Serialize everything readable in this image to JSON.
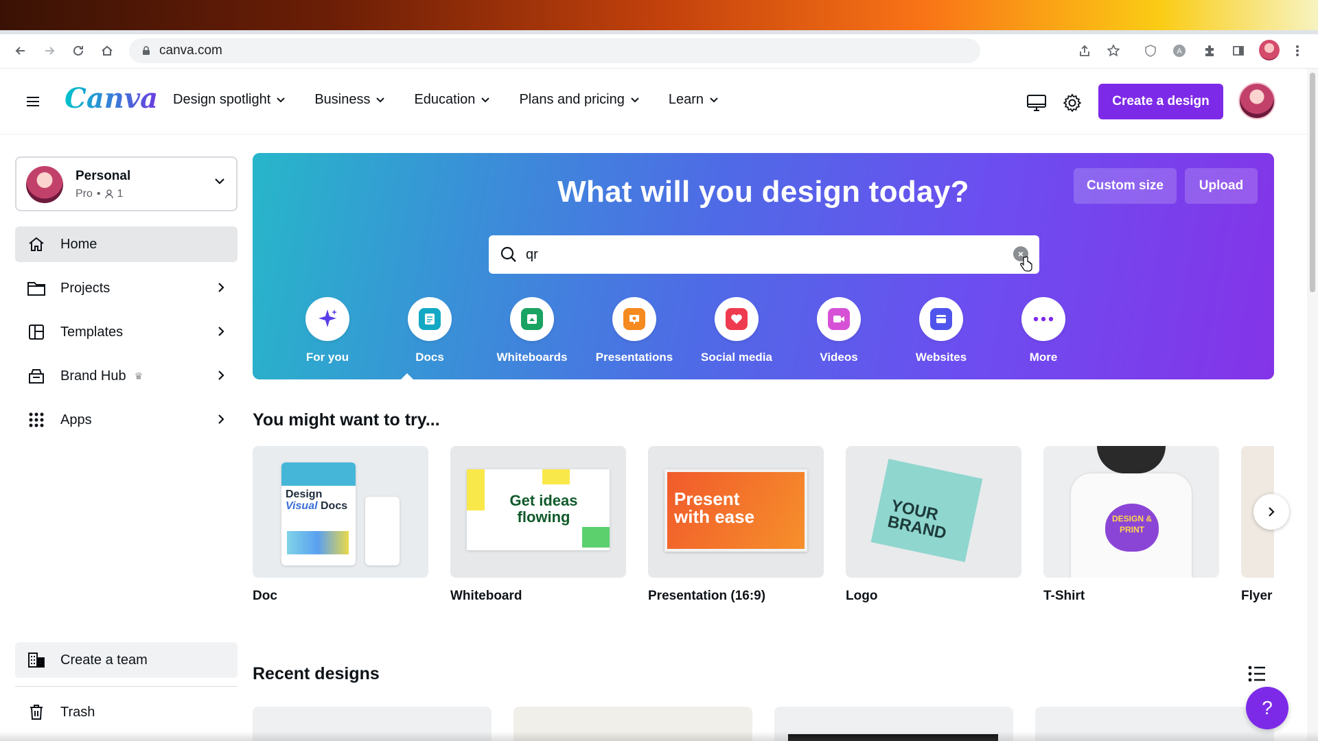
{
  "browser": {
    "url": "canva.com"
  },
  "header": {
    "logo": "Canva",
    "nav": [
      {
        "label": "Design spotlight"
      },
      {
        "label": "Business"
      },
      {
        "label": "Education"
      },
      {
        "label": "Plans and pricing"
      },
      {
        "label": "Learn"
      }
    ],
    "create_label": "Create a design",
    "icons": [
      "desktop-icon",
      "gear-icon"
    ]
  },
  "sidebar": {
    "account": {
      "name": "Personal",
      "plan": "Pro",
      "members": "1"
    },
    "items": [
      {
        "label": "Home",
        "icon": "home-icon",
        "active": true
      },
      {
        "label": "Projects",
        "icon": "folder-icon"
      },
      {
        "label": "Templates",
        "icon": "templates-icon"
      },
      {
        "label": "Brand Hub",
        "icon": "brand-hub-icon",
        "badge": "♛"
      },
      {
        "label": "Apps",
        "icon": "apps-grid-icon"
      }
    ],
    "create_team_label": "Create a team",
    "trash_label": "Trash"
  },
  "hero": {
    "title": "What will you design today?",
    "custom_size_label": "Custom size",
    "upload_label": "Upload",
    "search_value": "qr",
    "categories": [
      {
        "label": "For you",
        "icon": "sparkle-icon",
        "color": "#5b3ee8"
      },
      {
        "label": "Docs",
        "icon": "docs-icon",
        "color": "#13a8c4"
      },
      {
        "label": "Whiteboards",
        "icon": "whiteboard-icon",
        "color": "#1aa362"
      },
      {
        "label": "Presentations",
        "icon": "presentation-icon",
        "color": "#f58a1f"
      },
      {
        "label": "Social media",
        "icon": "heart-icon",
        "color": "#ef3b4f"
      },
      {
        "label": "Videos",
        "icon": "video-icon",
        "color": "#d651d6"
      },
      {
        "label": "Websites",
        "icon": "website-icon",
        "color": "#4f55ec"
      },
      {
        "label": "More",
        "icon": "more-icon",
        "color": "#7d2ae8"
      }
    ]
  },
  "try_section": {
    "title": "You might want to try...",
    "cards": [
      {
        "label": "Doc",
        "thumb_text": [
          "Design",
          "Visual",
          "Docs"
        ]
      },
      {
        "label": "Whiteboard",
        "thumb_text": [
          "Get ideas",
          "flowing"
        ]
      },
      {
        "label": "Presentation (16:9)",
        "thumb_text": [
          "Present",
          "with ease"
        ]
      },
      {
        "label": "Logo",
        "thumb_text": [
          "YOUR",
          "BRAND"
        ]
      },
      {
        "label": "T-Shirt",
        "thumb_text": [
          "DESIGN &",
          "PRINT"
        ]
      },
      {
        "label": "Flyer"
      }
    ]
  },
  "recent": {
    "title": "Recent designs"
  },
  "help_label": "?",
  "colors": {
    "accent": "#7d2ae8",
    "hero_start": "#27b6c9",
    "hero_end": "#8434e8"
  }
}
